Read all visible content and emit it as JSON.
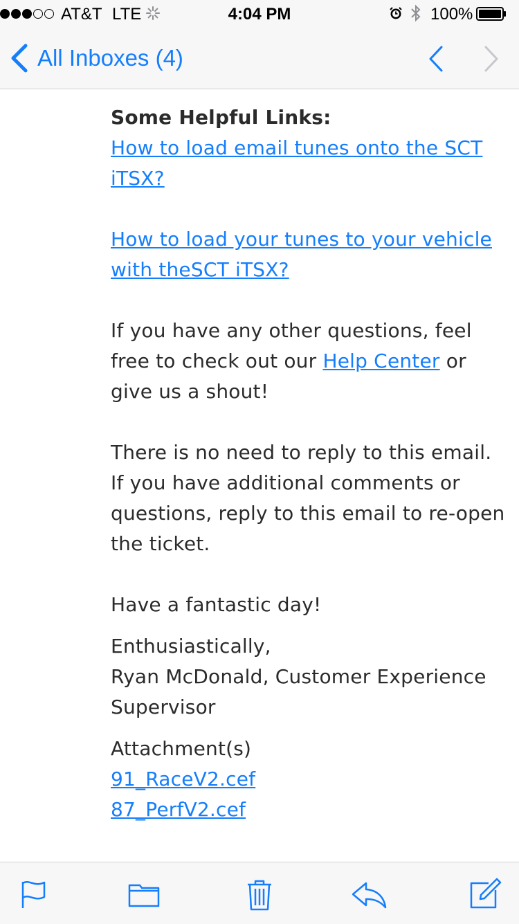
{
  "status_bar": {
    "carrier": "AT&T",
    "network": "LTE",
    "time": "4:04 PM",
    "battery": "100%",
    "signal_bars_filled": 3,
    "signal_bars_total": 5
  },
  "nav": {
    "back_label": "All Inboxes (4)",
    "icons": [
      "chevron-left-icon",
      "chevron-up-icon",
      "chevron-down-icon"
    ]
  },
  "email": {
    "helpful_links_heading": "Some Helpful Links:",
    "link_email_tunes": "How to load email tunes onto the SCT iTSX?",
    "link_vehicle_tunes": "How to load your tunes to your vehicle with theSCT iTSX?",
    "questions_before": "If you have any other questions, feel free to check out our ",
    "help_center_link": "Help Center",
    "questions_after": " or give us a shout!",
    "no_reply_text": "There is no need to reply to this email. If you have additional comments or questions, reply to this email to re-open the ticket.",
    "closing": "Have a fantastic day!",
    "signoff": "Enthusiastically,",
    "signature": "Ryan McDonald, Customer Experience Supervisor",
    "attachments_label": "Attachment(s)",
    "attachments": [
      "91_RaceV2.cef",
      "87_PerfV2.cef"
    ]
  },
  "toolbar": {
    "icons": [
      "flag-icon",
      "folder-icon",
      "trash-icon",
      "reply-icon",
      "compose-icon"
    ]
  },
  "colors": {
    "accent": "#157efb",
    "text": "#2b2b2b",
    "bar_background": "#f7f7f8"
  }
}
